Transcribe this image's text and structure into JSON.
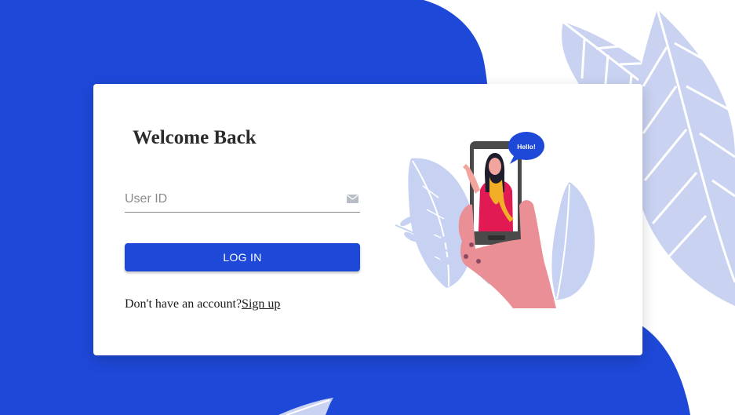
{
  "login": {
    "title": "Welcome Back",
    "user_id_placeholder": "User ID",
    "user_id_value": "",
    "login_label": "LOG IN",
    "signup_prompt": "Don't have an account?",
    "signup_link": "Sign up"
  },
  "illustration": {
    "bubble_text": "Hello!"
  },
  "colors": {
    "brand_blue": "#1e48d8",
    "leaf_lavender": "#c7d2f2",
    "skin": "#ea8f95",
    "dress": "#e11a54",
    "scarf": "#f3ae27"
  },
  "icons": {
    "user_id_field": "mail-icon"
  }
}
